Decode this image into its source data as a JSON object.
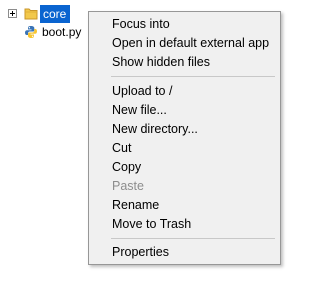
{
  "tree": {
    "items": [
      {
        "label": "core",
        "icon": "folder-icon",
        "expanded": false,
        "selected": true
      },
      {
        "label": "boot.py",
        "icon": "python-file-icon"
      }
    ]
  },
  "context_menu": {
    "items": [
      {
        "label": "Focus into",
        "enabled": true
      },
      {
        "label": "Open in default external app",
        "enabled": true
      },
      {
        "label": "Show hidden files",
        "enabled": true
      },
      {
        "label": "Upload to /",
        "enabled": true
      },
      {
        "label": "New file...",
        "enabled": true
      },
      {
        "label": "New directory...",
        "enabled": true
      },
      {
        "label": "Cut",
        "enabled": true
      },
      {
        "label": "Copy",
        "enabled": true
      },
      {
        "label": "Paste",
        "enabled": false
      },
      {
        "label": "Rename",
        "enabled": true
      },
      {
        "label": "Move to Trash",
        "enabled": true
      },
      {
        "label": "Properties",
        "enabled": true
      }
    ]
  },
  "colors": {
    "selection": "#0a64d0",
    "menu_background": "#f0f0f0",
    "disabled_text": "#8d8d8d"
  }
}
